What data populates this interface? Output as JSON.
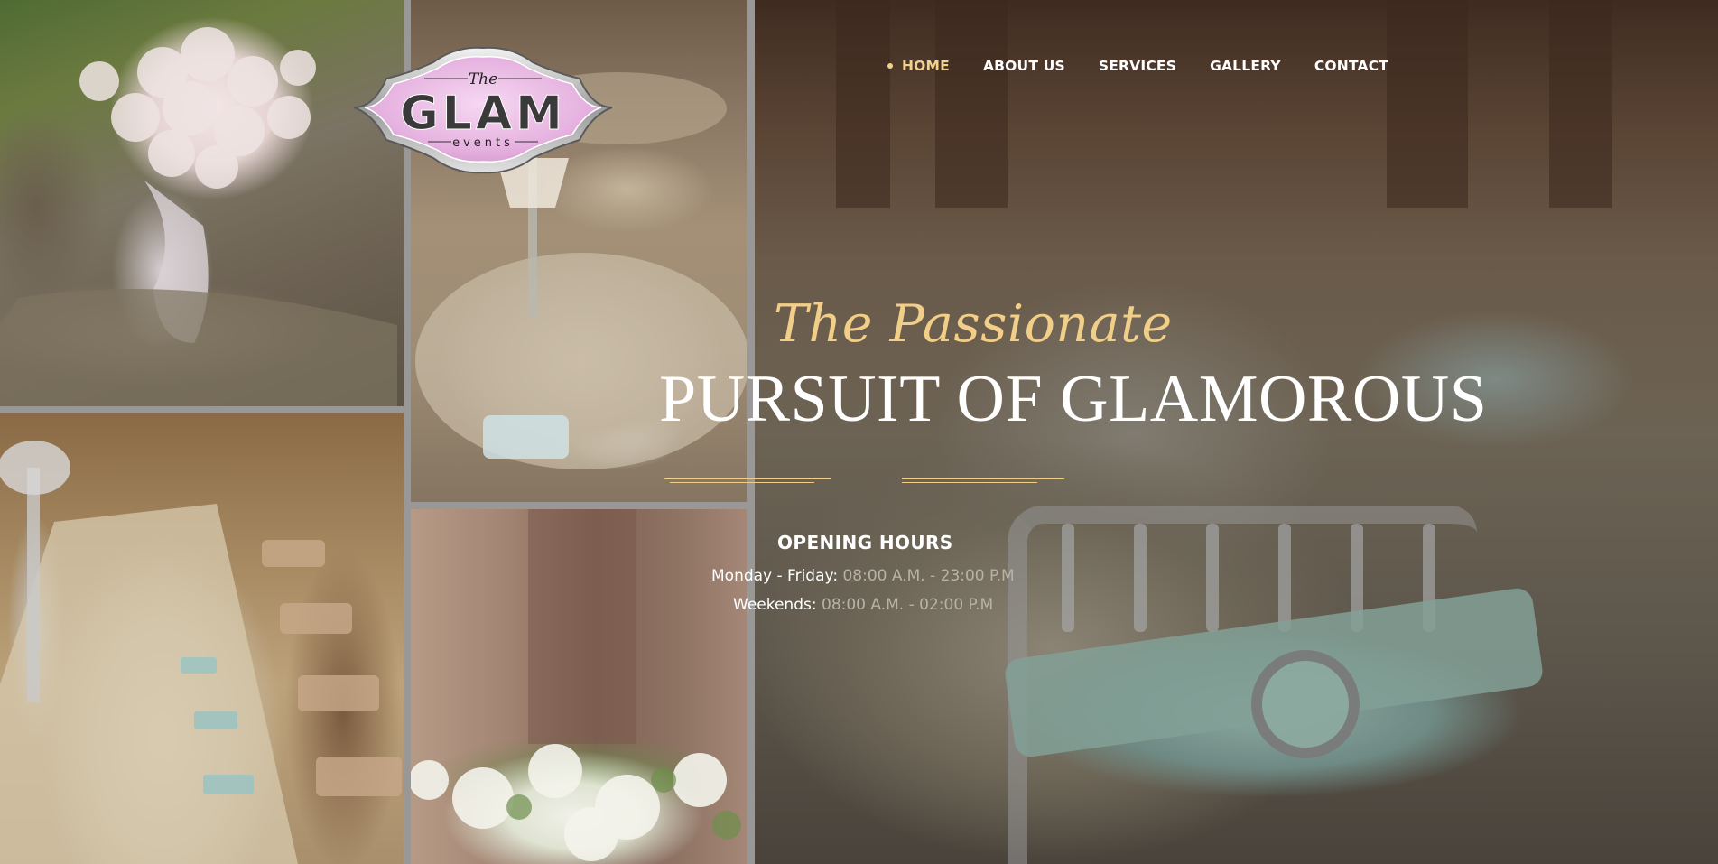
{
  "colors": {
    "accent_gold": "#f2cf88",
    "nav_active": "#f3d28d",
    "text_white": "#ffffff",
    "time_grey": "#b8b2a8"
  },
  "logo": {
    "top_text": "The",
    "main_text": "GLAM",
    "sub_text": "events"
  },
  "nav": {
    "items": [
      {
        "label": "HOME",
        "active": true
      },
      {
        "label": "ABOUT US",
        "active": false
      },
      {
        "label": "SERVICES",
        "active": false
      },
      {
        "label": "GALLERY",
        "active": false
      },
      {
        "label": "CONTACT",
        "active": false
      }
    ]
  },
  "hero": {
    "tagline": "The Passionate",
    "headline": "PURSUIT OF GLAMOROUS"
  },
  "hours": {
    "title": "OPENING HOURS",
    "weekdays_label": "Monday - Friday:",
    "weekdays_time": "08:00 A.M. - 23:00 P.M",
    "weekends_label": "Weekends:",
    "weekends_time": "08:00 A.M. - 02:00 P.M"
  },
  "gallery": {
    "images": [
      "bridal-bouquet",
      "banquet-hall-tables",
      "long-dining-table",
      "white-flower-arrangement"
    ]
  }
}
